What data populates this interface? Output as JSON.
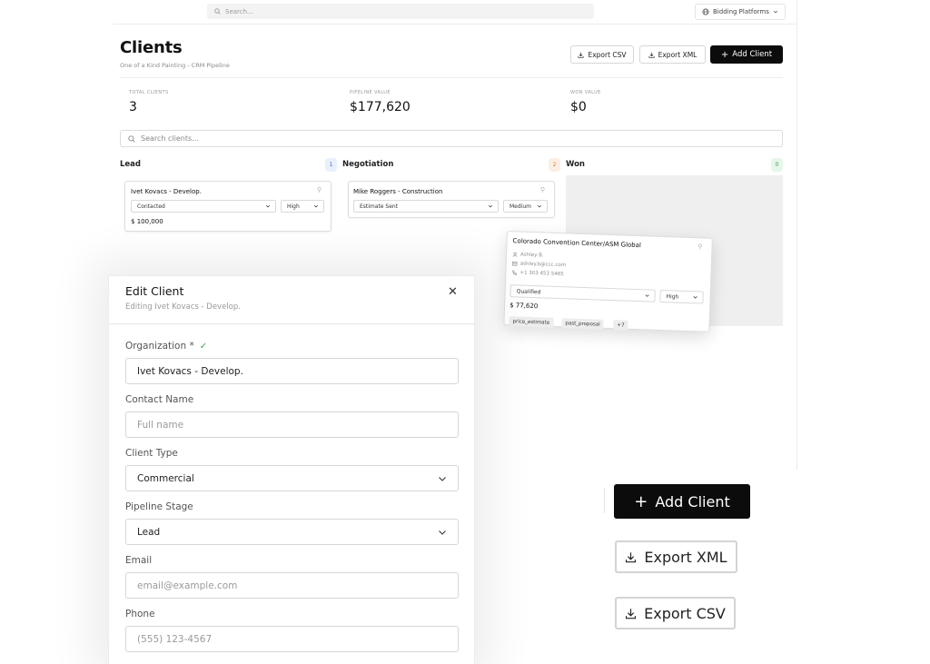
{
  "topbar": {
    "search_placeholder": "Search...",
    "platforms_label": "Bidding Platforms"
  },
  "page": {
    "title": "Clients",
    "subtitle": "One of a Kind Painting - CRM Pipeline"
  },
  "toolbar": {
    "export_csv": "Export CSV",
    "export_xml": "Export XML",
    "add_client": "Add Client"
  },
  "stats": [
    {
      "label": "TOTAL CLIENTS",
      "value": "3"
    },
    {
      "label": "PIPELINE VALUE",
      "value": "$177,620"
    },
    {
      "label": "WON VALUE",
      "value": "$0"
    }
  ],
  "client_search": {
    "placeholder": "Search clients..."
  },
  "columns": [
    {
      "name": "Lead",
      "count": "1"
    },
    {
      "name": "Negotiation",
      "count": "2"
    },
    {
      "name": "Won",
      "count": "0"
    }
  ],
  "cards": {
    "lead": {
      "title": "Ivet Kovacs - Develop.",
      "status": "Contacted",
      "priority": "High",
      "currency": "$",
      "amount": "100,000"
    },
    "negotiation": {
      "title": "Mike Roggers - Construction",
      "status": "Estimate Sent",
      "priority": "Medium"
    },
    "dragging": {
      "title": "Colorado Convention Center/ASM Global",
      "contact": "Ashley B.",
      "email": "ashley.b@ccc.com",
      "phone": "+1 303 453 5465",
      "status": "Qualified",
      "priority": "High",
      "currency": "$",
      "amount": "77,620",
      "tags": [
        "price_estimate",
        "past_proposal",
        "+7"
      ]
    }
  },
  "modal": {
    "title": "Edit Client",
    "subtitle": "Editing Ivet Kovacs - Develop.",
    "fields": {
      "organization": {
        "label": "Organization *",
        "value": "Ivet Kovacs - Develop."
      },
      "contact_name": {
        "label": "Contact Name",
        "placeholder": "Full name"
      },
      "client_type": {
        "label": "Client Type",
        "value": "Commercial"
      },
      "pipeline_stage": {
        "label": "Pipeline Stage",
        "value": "Lead"
      },
      "email": {
        "label": "Email",
        "placeholder": "email@example.com"
      },
      "phone": {
        "label": "Phone",
        "placeholder": "(555) 123-4567"
      }
    }
  },
  "big_buttons": {
    "add_client": "Add Client",
    "export_xml": "Export XML",
    "export_csv": "Export CSV"
  },
  "colors": {
    "primary": "#0c0c0c",
    "count_lead_bg": "#e8f0fb",
    "count_lead_fg": "#3b6fd0",
    "count_neg_bg": "#fdeee3",
    "count_neg_fg": "#e07a2e",
    "count_won_bg": "#e6f6ea",
    "count_won_fg": "#3a9a55",
    "success": "#3fa45b"
  },
  "icons": {
    "search": "search-icon",
    "globe": "globe-icon",
    "chevron": "chevron-down-icon",
    "download": "download-icon",
    "plus": "plus-icon",
    "pin": "pin-icon",
    "close": "close-icon",
    "check": "check-icon",
    "user": "user-icon",
    "mail": "mail-icon",
    "phone": "phone-icon"
  }
}
